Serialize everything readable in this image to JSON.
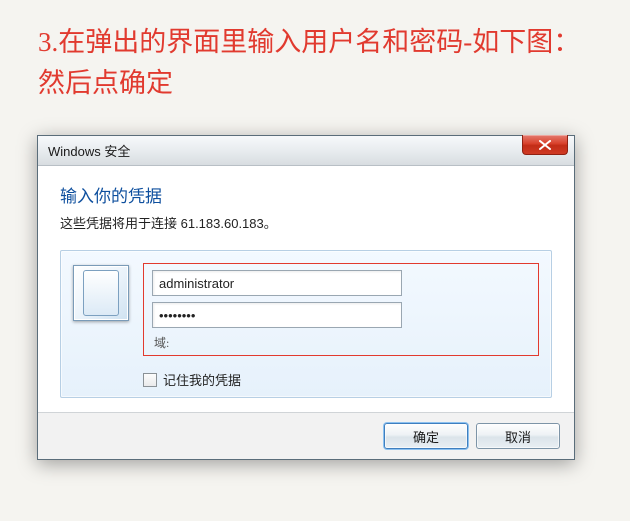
{
  "instruction": "3.在弹出的界面里输入用户名和密码-如下图：然后点确定",
  "dialog": {
    "title": "Windows 安全",
    "heading": "输入你的凭据",
    "subtext": "这些凭据将用于连接 61.183.60.183。",
    "username": "administrator",
    "password": "••••••••",
    "domain_label": "域:",
    "remember_label": "记住我的凭据",
    "ok_label": "确定",
    "cancel_label": "取消"
  }
}
